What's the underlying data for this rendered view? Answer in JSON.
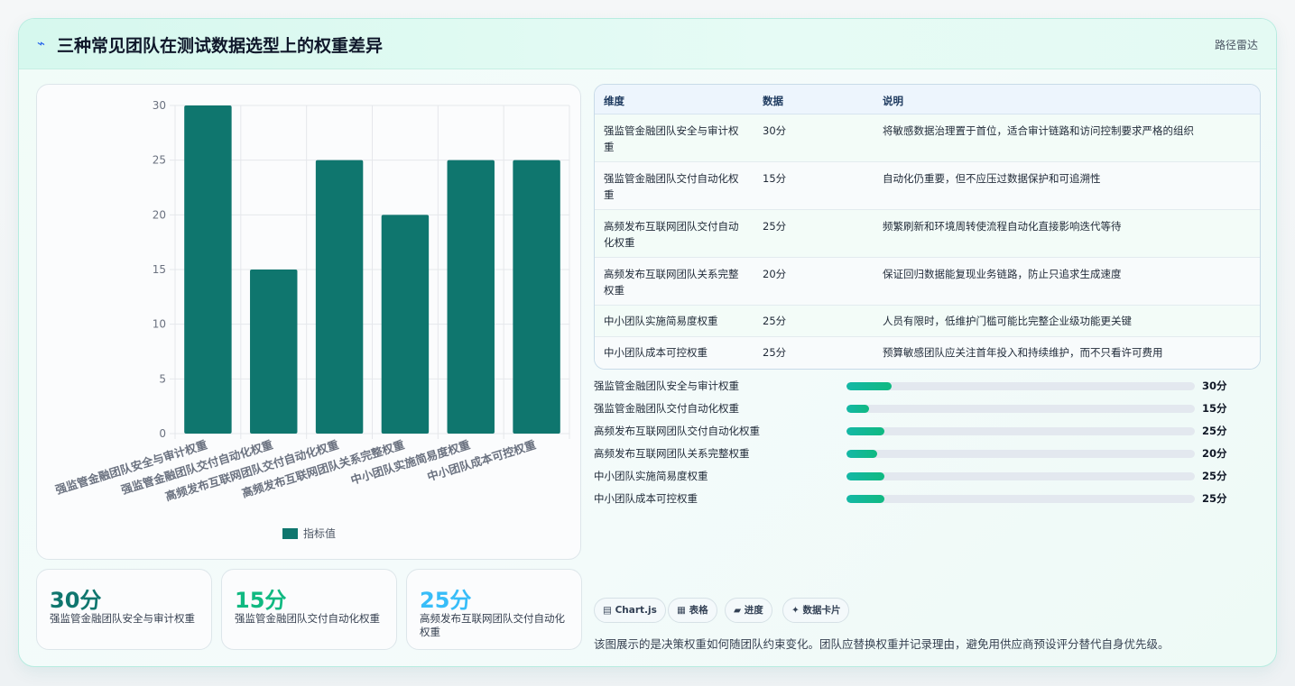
{
  "header": {
    "icon": "bolt-icon",
    "title": "三种常见团队在测试数据选型上的权重差异",
    "tag": "路径雷达"
  },
  "chart_data": {
    "type": "bar",
    "categories": [
      "强监管金融团队安全与审计权重",
      "强监管金融团队交付自动化权重",
      "高频发布互联网团队交付自动化权重",
      "高频发布互联网团队关系完整权重",
      "中小团队实施简易度权重",
      "中小团队成本可控权重"
    ],
    "series": [
      {
        "name": "指标值",
        "values": [
          30,
          15,
          25,
          20,
          25,
          25
        ]
      }
    ],
    "ylim": [
      0,
      30
    ],
    "yticks": [
      0,
      5,
      10,
      15,
      20,
      25,
      30
    ],
    "legend": "bottom",
    "grid": true,
    "color": "#0f766e"
  },
  "kpis": [
    {
      "value": "30分",
      "label": "强监管金融团队安全与审计权重",
      "color": "#0f766e"
    },
    {
      "value": "15分",
      "label": "强监管金融团队交付自动化权重",
      "color": "#10b981"
    },
    {
      "value": "25分",
      "label": "高频发布互联网团队交付自动化权重",
      "color": "#38bdf8"
    }
  ],
  "table": {
    "headers": [
      "维度",
      "数据",
      "说明"
    ],
    "rows": [
      {
        "dim": "强监管金融团队安全与审计权重",
        "data": "30分",
        "note": "将敏感数据治理置于首位，适合审计链路和访问控制要求严格的组织"
      },
      {
        "dim": "强监管金融团队交付自动化权重",
        "data": "15分",
        "note": "自动化仍重要，但不应压过数据保护和可追溯性"
      },
      {
        "dim": "高频发布互联网团队交付自动化权重",
        "data": "25分",
        "note": "频繁刷新和环境周转使流程自动化直接影响迭代等待"
      },
      {
        "dim": "高频发布互联网团队关系完整权重",
        "data": "20分",
        "note": "保证回归数据能复现业务链路，防止只追求生成速度"
      },
      {
        "dim": "中小团队实施简易度权重",
        "data": "25分",
        "note": "人员有限时，低维护门槛可能比完整企业级功能更关键"
      },
      {
        "dim": "中小团队成本可控权重",
        "data": "25分",
        "note": "预算敏感团队应关注首年投入和持续维护，而不只看许可费用"
      }
    ]
  },
  "progress": [
    {
      "label": "强监管金融团队安全与审计权重",
      "value": "30分",
      "fraction": 0.13
    },
    {
      "label": "强监管金融团队交付自动化权重",
      "value": "15分",
      "fraction": 0.065
    },
    {
      "label": "高频发布互联网团队交付自动化权重",
      "value": "25分",
      "fraction": 0.108
    },
    {
      "label": "高频发布互联网团队关系完整权重",
      "value": "20分",
      "fraction": 0.087
    },
    {
      "label": "中小团队实施简易度权重",
      "value": "25分",
      "fraction": 0.108
    },
    {
      "label": "中小团队成本可控权重",
      "value": "25分",
      "fraction": 0.108
    }
  ],
  "pills": [
    "▤ Chart.js",
    "▦ 表格",
    "▰ 进度",
    "✦ 数据卡片"
  ],
  "footer": "该图展示的是决策权重如何随团队约束变化。团队应替换权重并记录理由，避免用供应商预设评分替代自身优先级。"
}
